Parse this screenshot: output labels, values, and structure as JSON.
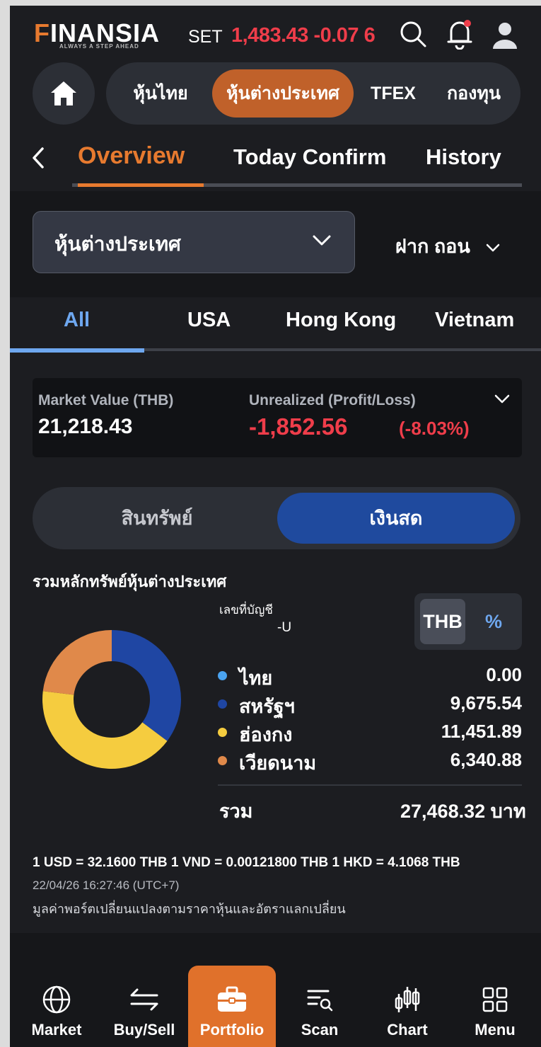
{
  "header": {
    "logo": "FINANSIA",
    "logo_tagline": "ALWAYS A STEP AHEAD",
    "index_label": "SET",
    "index_value": "1,483.43 -0.07 6",
    "colors": {
      "accent": "#e77a2f",
      "negative": "#ef3d4a",
      "highlight": "#6ea7ef"
    }
  },
  "market_tabs": [
    {
      "label": "หุ้นไทย"
    },
    {
      "label": "หุ้นต่างประเทศ",
      "active": true
    },
    {
      "label": "TFEX"
    },
    {
      "label": "กองทุน"
    }
  ],
  "sub_tabs": [
    {
      "label": "Overview",
      "active": true
    },
    {
      "label": "Today Confirm"
    },
    {
      "label": "History"
    }
  ],
  "account": {
    "selector": "หุ้นต่างประเทศ",
    "deposit_withdraw": "ฝาก ถอน"
  },
  "region_tabs": [
    {
      "label": "All",
      "active": true
    },
    {
      "label": "USA"
    },
    {
      "label": "Hong Kong"
    },
    {
      "label": "Vietnam"
    }
  ],
  "summary": {
    "market_value_label": "Market Value (THB)",
    "market_value": "21,218.43",
    "unrealized_label": "Unrealized (Profit/Loss)",
    "unrealized": "-1,852.56",
    "unrealized_pct": "(-8.03%)"
  },
  "asset_toggle": {
    "assets": "สินทรัพย์",
    "cash": "เงินสด",
    "active": "cash"
  },
  "portfolio": {
    "title": "รวมหลักทรัพย์หุ้นต่างประเทศ",
    "account_label": "เลขที่บัญชี",
    "account_value": "-U",
    "unit_thb": "THB",
    "unit_pct": "%",
    "total_label": "รวม",
    "total_value": "27,468.32 บาท"
  },
  "chart_data": {
    "type": "pie",
    "categories": [
      "ไทย",
      "สหรัฐฯ",
      "ฮ่องกง",
      "เวียดนาม"
    ],
    "values": [
      0.0,
      9675.54,
      11451.89,
      6340.88
    ],
    "display_values": [
      "0.00",
      "9,675.54",
      "11,451.89",
      "6,340.88"
    ],
    "colors": [
      "#4aa3f0",
      "#1f46a3",
      "#f5cc3f",
      "#e0894a"
    ]
  },
  "footer": {
    "fx_rates": "1 USD = 32.1600 THB   1 VND = 0.00121800 THB   1 HKD = 4.1068 THB",
    "timestamp": "22/04/26 16:27:46 (UTC+7)",
    "note": "มูลค่าพอร์ตเปลี่ยนแปลงตามราคาหุ้นและอัตราแลกเปลี่ยน"
  },
  "bottom_nav": [
    {
      "label": "Market",
      "icon": "globe-icon"
    },
    {
      "label": "Buy/Sell",
      "icon": "swap-arrows-icon"
    },
    {
      "label": "Portfolio",
      "icon": "briefcase-icon",
      "active": true
    },
    {
      "label": "Scan",
      "icon": "scan-list-icon"
    },
    {
      "label": "Chart",
      "icon": "candlestick-icon"
    },
    {
      "label": "Menu",
      "icon": "grid-icon"
    }
  ]
}
